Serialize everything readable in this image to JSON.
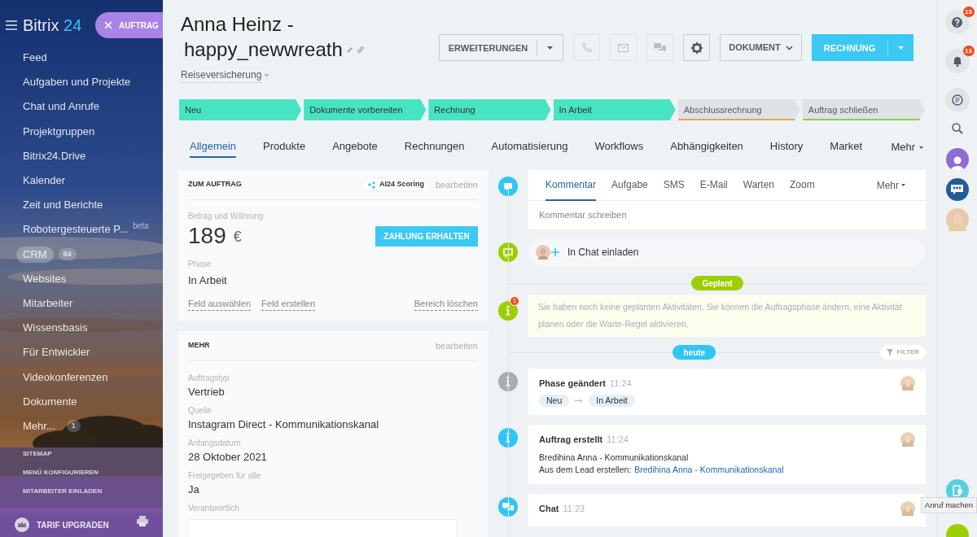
{
  "sidebar": {
    "logo_text": "Bitrix",
    "logo_number": "24",
    "create_button": "AUFTRAG",
    "items": [
      {
        "label": "Feed",
        "selected": false
      },
      {
        "label": "Aufgaben und Projekte",
        "selected": false
      },
      {
        "label": "Chat und Anrufe",
        "selected": false
      },
      {
        "label": "Projektgruppen",
        "selected": false
      },
      {
        "label": "Bitrix24.Drive",
        "selected": false
      },
      {
        "label": "Kalender",
        "selected": false
      },
      {
        "label": "Zeit und Berichte",
        "selected": false
      },
      {
        "label": "Robotergesteuerte P...",
        "tag": "beta",
        "selected": false
      },
      {
        "label": "CRM",
        "counter": "94",
        "selected": true
      },
      {
        "label": "Websites",
        "selected": false
      },
      {
        "label": "Mitarbeiter",
        "selected": false
      },
      {
        "label": "Wissensbasis",
        "selected": false
      },
      {
        "label": "Für Entwickler",
        "selected": false
      },
      {
        "label": "Videokonferenzen",
        "selected": false
      },
      {
        "label": "Dokumente",
        "selected": false
      },
      {
        "label": "Mehr...",
        "counter": "1",
        "selected": false
      }
    ],
    "footer_links": [
      "SITEMAP",
      "MENÜ KONFIGURIEREN",
      "MITARBEITER EINLADEN"
    ],
    "upgrade": "TARIF UPGRADEN"
  },
  "header": {
    "title_line1": "Anna Heinz -",
    "title_line2": "happy_newwreath",
    "category": "Reiseversicherung",
    "extensions_button": "ERWEITERUNGEN",
    "document_button": "DOKUMENT",
    "invoice_button": "RECHNUNG"
  },
  "stages": [
    {
      "label": "Neu",
      "reached": true,
      "color": "#47e4c2"
    },
    {
      "label": "Dokumente vorbereiten",
      "reached": true,
      "color": "#47e4c2"
    },
    {
      "label": "Rechnung",
      "reached": true,
      "color": "#47e4c2"
    },
    {
      "label": "In Arbeit",
      "reached": true,
      "color": "#47e4c2"
    },
    {
      "label": "Abschlussrechnung",
      "reached": false,
      "color": "#f0a33a"
    },
    {
      "label": "Auftrag schließen",
      "reached": false,
      "color": "#8fd13b"
    }
  ],
  "tabs": [
    {
      "label": "Allgemein",
      "selected": true
    },
    {
      "label": "Produkte",
      "selected": false
    },
    {
      "label": "Angebote",
      "selected": false
    },
    {
      "label": "Rechnungen",
      "selected": false
    },
    {
      "label": "Automatisierung",
      "selected": false
    },
    {
      "label": "Workflows",
      "selected": false
    },
    {
      "label": "Abhängigkeiten",
      "selected": false
    },
    {
      "label": "History",
      "selected": false
    },
    {
      "label": "Market",
      "selected": false
    }
  ],
  "tabs_more": "Mehr",
  "order_card": {
    "title": "ZUM AUFTRAG",
    "scoring_badge": "AI24 Scoring",
    "edit_link": "bearbeiten",
    "amount_label": "Betrag und Währung",
    "amount": "189",
    "currency": "€",
    "payment_button": "ZAHLUNG ERHALTEN",
    "phase_label": "Phase",
    "phase_value": "In Arbeit",
    "links": [
      "Feld auswählen",
      "Feld erstellen"
    ],
    "clear_link": "Bereich löschen"
  },
  "more_card": {
    "title": "MEHR",
    "edit_link": "bearbeiten",
    "fields": [
      {
        "label": "Auftragstyp",
        "value": "Vertrieb"
      },
      {
        "label": "Quelle",
        "value": "Instagram Direct - Kommunikationskanal"
      },
      {
        "label": "Anfangsdatum",
        "value": "28 Oktober 2021"
      },
      {
        "label": "Freigegeben für alle",
        "value": "Ja"
      }
    ],
    "responsible_label": "Verantwortlich"
  },
  "composer": {
    "tabs": [
      {
        "label": "Kommentar",
        "selected": true
      },
      {
        "label": "Aufgabe",
        "selected": false
      },
      {
        "label": "SMS",
        "selected": false
      },
      {
        "label": "E-Mail",
        "selected": false
      },
      {
        "label": "Warten",
        "selected": false
      },
      {
        "label": "Zoom",
        "selected": false
      }
    ],
    "more": "Mehr",
    "placeholder": "Kommentar schreiben"
  },
  "chat_invite": "In Chat einladen",
  "planned_label": "Geplant",
  "notice": {
    "text": "Sie haben noch keine geplanten Aktivitäten. Sie können die Auftragsphase ändern, eine Aktivität planen oder die Warte-Regel aktivieren.",
    "counter": "1"
  },
  "today_label": "heute",
  "filter_button": "FILTER",
  "events": [
    {
      "kind": "phase",
      "color": "#a8adb4",
      "title": "Phase geändert",
      "time": "11:24",
      "from": "Neu",
      "to": "In Arbeit"
    },
    {
      "kind": "created",
      "color": "#2fc6f6",
      "title": "Auftrag erstellt",
      "time": "11:24",
      "line": "Bredihina Anna - Kommunikationskanal",
      "lead_prefix": "Aus dem Lead erstellen:",
      "lead_link": "Bredihina Anna - Kommunikationskanal"
    },
    {
      "kind": "chat",
      "color": "#2fc6f6",
      "title": "Chat",
      "time": "11:23"
    }
  ],
  "right_bar": {
    "help_counter": "15",
    "notifications_counter": "13",
    "tooltip": "Anruf machen"
  }
}
